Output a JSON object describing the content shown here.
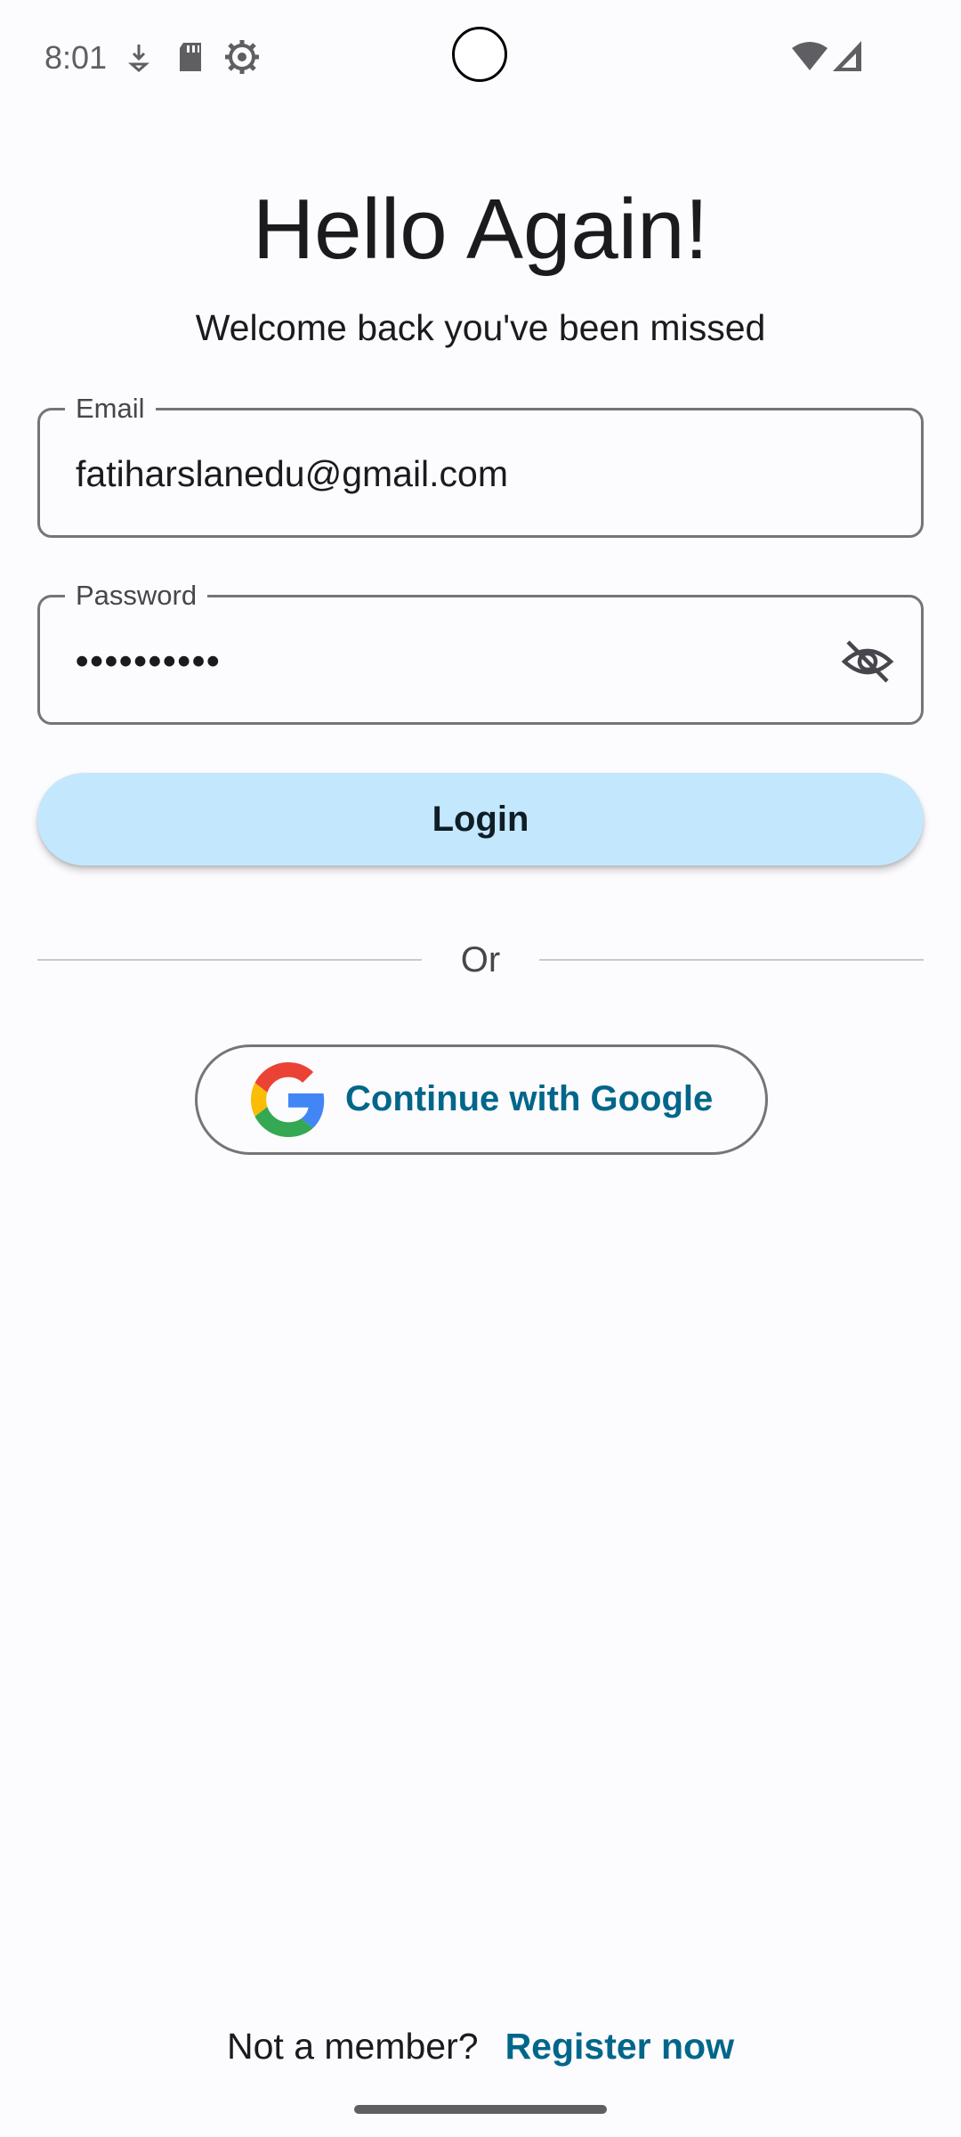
{
  "status_bar": {
    "time": "8:01",
    "icons": [
      "download-icon",
      "sd-card-icon",
      "settings-gear-icon",
      "wifi-icon",
      "cell-signal-icon"
    ]
  },
  "header": {
    "title": "Hello Again!",
    "subtitle": "Welcome back you've been missed"
  },
  "form": {
    "email_label": "Email",
    "email_value": "fatiharslanedu@gmail.com",
    "password_label": "Password",
    "password_value": "••••••••••",
    "password_toggle_icon": "eye-off-icon"
  },
  "actions": {
    "login_label": "Login",
    "divider_text": "Or",
    "google_label": "Continue with Google"
  },
  "footer": {
    "prompt": "Not a member?",
    "register_link": "Register now"
  },
  "colors": {
    "background": "#fcfbfe",
    "login_button": "#c3e7fd",
    "accent": "#00668a",
    "outline": "#74747a"
  }
}
